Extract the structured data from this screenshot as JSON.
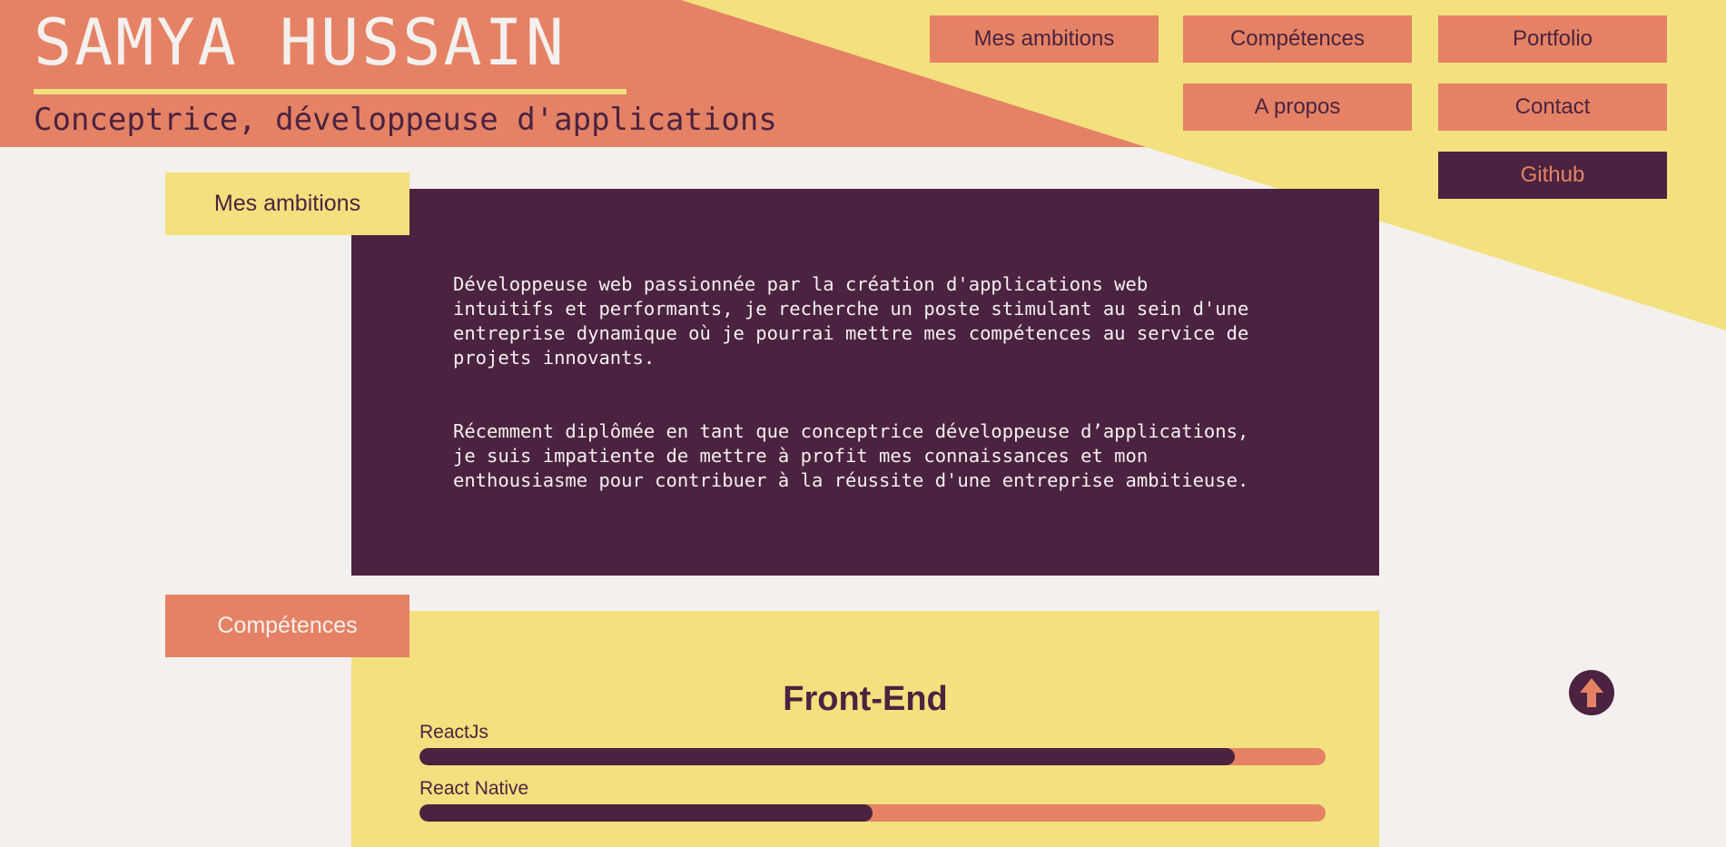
{
  "colors": {
    "coral": "#e58265",
    "yellow": "#f3e07e",
    "plum": "#4b2340",
    "cream": "#f4f0ee"
  },
  "header": {
    "name": "SAMYA HUSSAIN",
    "subtitle": "Conceptrice, développeuse d'applications"
  },
  "nav": {
    "ambitions": "Mes ambitions",
    "competences": "Compétences",
    "portfolio": "Portfolio",
    "apropos": "A propos",
    "contact": "Contact",
    "github": "Github"
  },
  "ambitions": {
    "tab_label": "Mes ambitions",
    "paragraph1": "Développeuse web passionnée par la création d'applications web\nintuitifs et performants, je recherche un poste stimulant au sein d'une\nentreprise dynamique où je pourrai mettre mes compétences au service de\nprojets innovants.",
    "paragraph2": "Récemment diplômée en tant que conceptrice développeuse d’applications,\nje suis impatiente de mettre à profit mes connaissances et mon\nenthousiasme pour contribuer à la réussite d'une entreprise ambitieuse."
  },
  "competences": {
    "tab_label": "Compétences",
    "group_title": "Front-End",
    "skills": [
      {
        "label": "ReactJs",
        "level": 0.9
      },
      {
        "label": "React Native",
        "level": 0.5
      }
    ]
  },
  "scroll_top": {
    "icon": "arrow-up-icon"
  }
}
